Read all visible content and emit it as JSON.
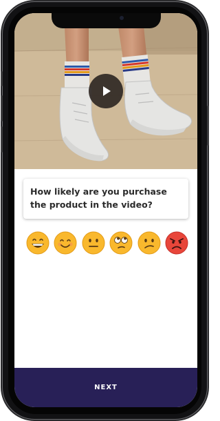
{
  "video": {
    "play_icon": "play-icon"
  },
  "survey": {
    "question": "How likely are you purchase the product in the video?",
    "rating_options": [
      {
        "name": "grinning-face-icon"
      },
      {
        "name": "smiling-face-icon"
      },
      {
        "name": "neutral-face-icon"
      },
      {
        "name": "rolling-eyes-face-icon"
      },
      {
        "name": "confused-face-icon"
      },
      {
        "name": "angry-face-icon"
      }
    ]
  },
  "footer": {
    "next_label": "NEXT"
  },
  "colors": {
    "footer_background": "#282057",
    "emoji_yellow": "#f9b82d",
    "emoji_angry": "#e8463a"
  }
}
